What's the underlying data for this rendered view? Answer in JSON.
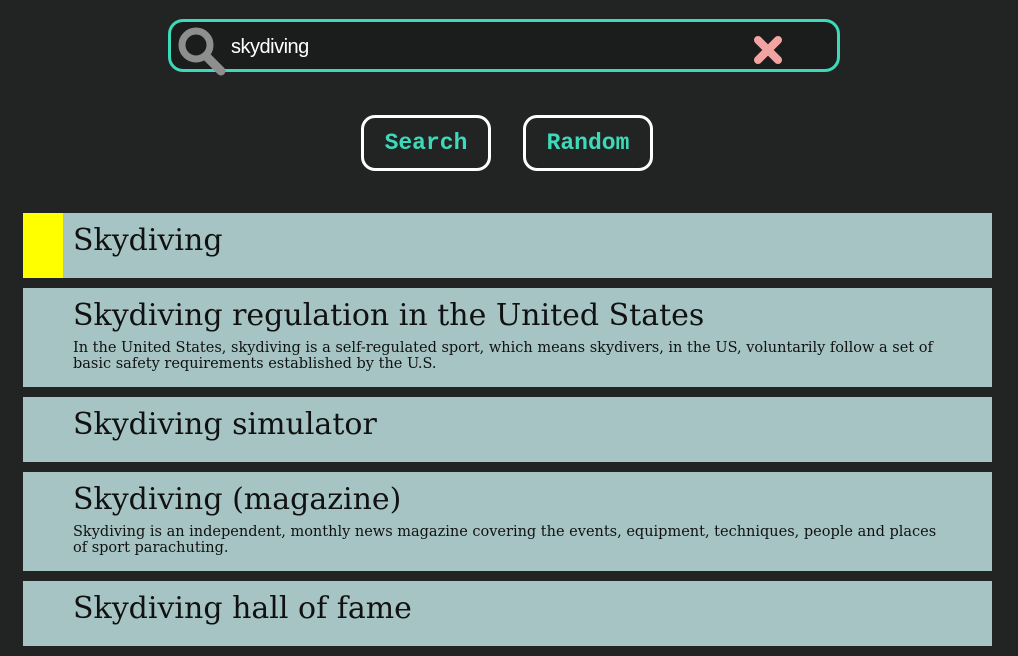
{
  "search": {
    "value": "skydiving"
  },
  "buttons": {
    "search_label": "Search",
    "random_label": "Random"
  },
  "colors": {
    "accent": "#3dd9b8",
    "highlight": "#ffff00",
    "result_bg": "#a6c4c4",
    "clear": "#f4a3a3",
    "background": "#222424"
  },
  "results": [
    {
      "title": "Skydiving",
      "snippet": ""
    },
    {
      "title": "Skydiving regulation in the United States",
      "snippet": "In the United States, skydiving is a self-regulated sport, which means skydivers, in the US, voluntarily follow a set of basic safety requirements established by the U.S."
    },
    {
      "title": "Skydiving simulator",
      "snippet": ""
    },
    {
      "title": "Skydiving (magazine)",
      "snippet": "Skydiving is an independent, monthly news magazine covering the events, equipment, techniques, people and places of sport parachuting."
    },
    {
      "title": "Skydiving hall of fame",
      "snippet": ""
    }
  ]
}
